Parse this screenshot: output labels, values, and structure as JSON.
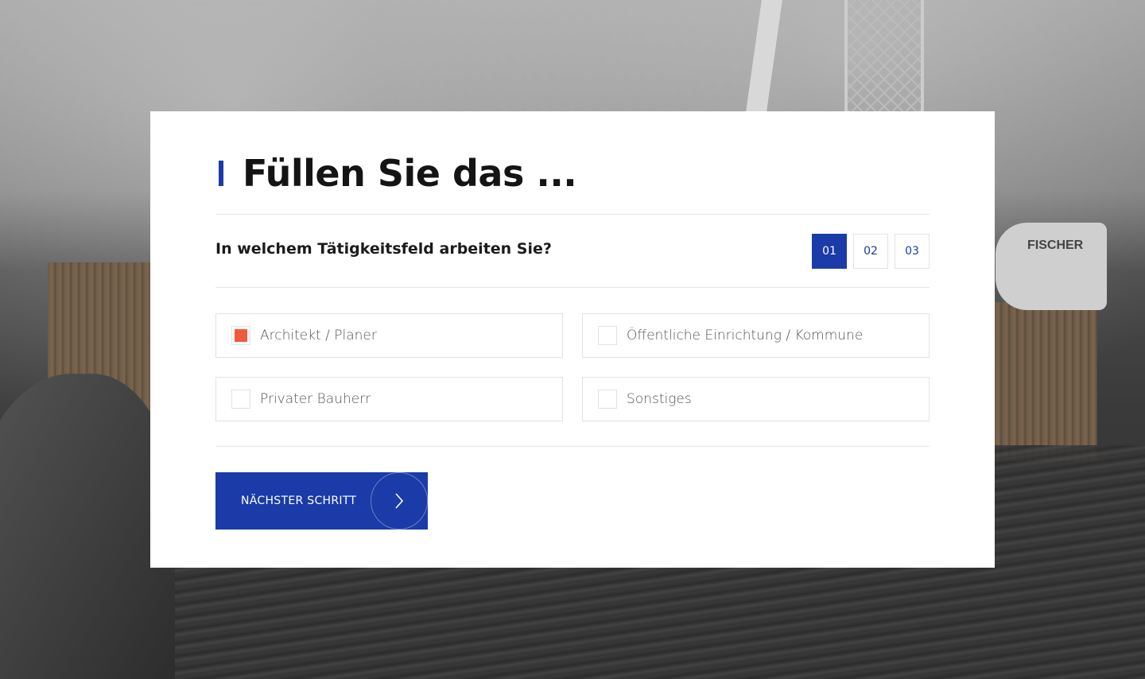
{
  "form": {
    "title": "Füllen Sie das ...",
    "question": "In welchem Tätigkeitsfeld arbeiten Sie?",
    "steps": [
      {
        "label": "01",
        "active": true
      },
      {
        "label": "02",
        "active": false
      },
      {
        "label": "03",
        "active": false
      }
    ],
    "options": [
      {
        "label": "Architekt / Planer",
        "checked": true
      },
      {
        "label": "Öffentliche Einrichtung / Kommune",
        "checked": false
      },
      {
        "label": "Privater Bauherr",
        "checked": false
      },
      {
        "label": "Sonstiges",
        "checked": false
      }
    ],
    "next_button": {
      "label": "NÄCHSTER SCHRITT",
      "icon": "chevron-right-icon"
    }
  },
  "background": {
    "truck_label": "FISCHER"
  },
  "colors": {
    "accent": "#1a3ba8",
    "checkbox_checked": "#f25a40"
  }
}
